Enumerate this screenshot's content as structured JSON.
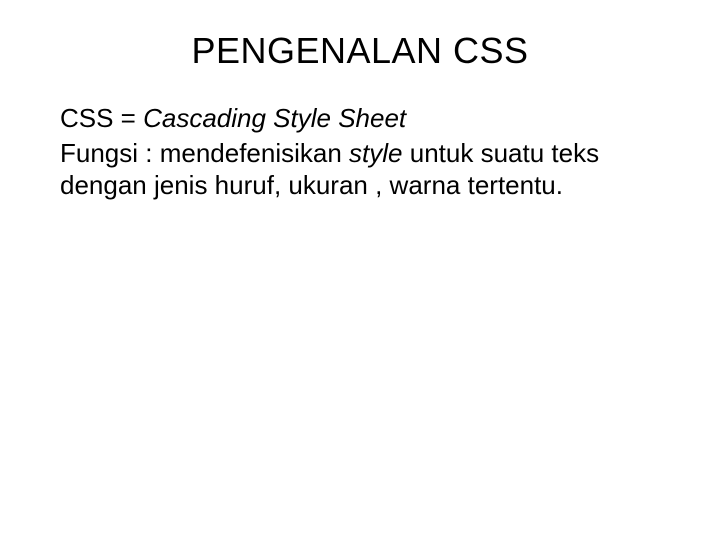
{
  "slide": {
    "title": "PENGENALAN CSS",
    "line1_prefix": "CSS = ",
    "line1_italic": "Cascading Style Sheet",
    "line2_part1": "Fungsi : mendefenisikan ",
    "line2_italic": "style",
    "line2_part2": " untuk suatu teks dengan jenis huruf, ukuran , warna tertentu."
  }
}
